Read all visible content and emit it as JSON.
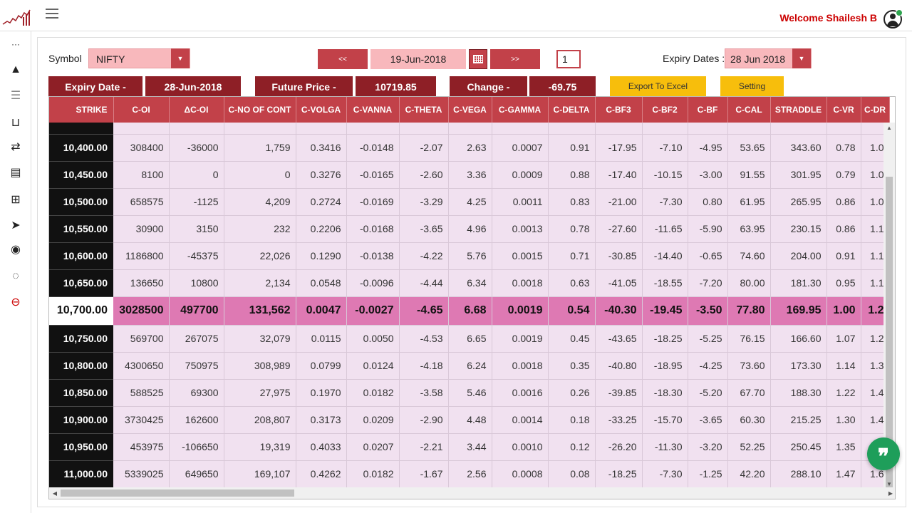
{
  "header": {
    "welcome": "Welcome Shailesh B",
    "logo_icon": "chart-logo-icon",
    "menu_icon": "hamburger-icon",
    "accent_color": "#c24149",
    "dark_accent": "#8e1f26",
    "welcome_color": "#cc0000"
  },
  "sidebar": {
    "items": [
      {
        "icon": "more-icon",
        "glyph": "···"
      },
      {
        "icon": "mountain-icon",
        "glyph": "▲"
      },
      {
        "icon": "list-lines-icon",
        "glyph": "☰"
      },
      {
        "icon": "basket-icon",
        "glyph": "⊔"
      },
      {
        "icon": "refresh-arrows-icon",
        "glyph": "⇄"
      },
      {
        "icon": "document-list-icon",
        "glyph": "▤"
      },
      {
        "icon": "map-icon",
        "glyph": "⊞"
      },
      {
        "icon": "paper-plane-icon",
        "glyph": "➤"
      },
      {
        "icon": "location-pin-icon",
        "glyph": "◉"
      },
      {
        "icon": "chat-bubble-icon",
        "glyph": "◌"
      },
      {
        "icon": "minus-circle-icon",
        "glyph": "⊖"
      }
    ]
  },
  "controls": {
    "symbol_label": "Symbol",
    "symbol_value": "NIFTY",
    "caret": "▼",
    "prev_label": "<<",
    "next_label": ">>",
    "date_value": "19-Jun-2018",
    "page_value": "1",
    "expiry_label": "Expiry Dates :",
    "expiry_value": "28 Jun 2018"
  },
  "info": {
    "expiry_label": "Expiry Date -",
    "expiry_value": "28-Jun-2018",
    "future_label": "Future Price -",
    "future_value": "10719.85",
    "change_label": "Change -",
    "change_value": "-69.75",
    "export_label": "Export To Excel",
    "setting_label": "Setting"
  },
  "table": {
    "headers": [
      "STRIKE",
      "C-OI",
      "ΔC-OI",
      "C-NO OF CONT",
      "C-VOLGA",
      "C-VANNA",
      "C-THETA",
      "C-VEGA",
      "C-GAMMA",
      "C-DELTA",
      "C-BF3",
      "C-BF2",
      "C-BF",
      "C-CAL",
      "STRADDLE",
      "C-VR",
      "C-DR"
    ],
    "rows": [
      [
        "10,400.00",
        "308400",
        "-36000",
        "1,759",
        "0.3416",
        "-0.0148",
        "-2.07",
        "2.63",
        "0.0007",
        "0.91",
        "-17.95",
        "-7.10",
        "-4.95",
        "53.65",
        "343.60",
        "0.78",
        "1.0"
      ],
      [
        "10,450.00",
        "8100",
        "0",
        "0",
        "0.3276",
        "-0.0165",
        "-2.60",
        "3.36",
        "0.0009",
        "0.88",
        "-17.40",
        "-10.15",
        "-3.00",
        "91.55",
        "301.95",
        "0.79",
        "1.0"
      ],
      [
        "10,500.00",
        "658575",
        "-1125",
        "4,209",
        "0.2724",
        "-0.0169",
        "-3.29",
        "4.25",
        "0.0011",
        "0.83",
        "-21.00",
        "-7.30",
        "0.80",
        "61.95",
        "265.95",
        "0.86",
        "1.0"
      ],
      [
        "10,550.00",
        "30900",
        "3150",
        "232",
        "0.2206",
        "-0.0168",
        "-3.65",
        "4.96",
        "0.0013",
        "0.78",
        "-27.60",
        "-11.65",
        "-5.90",
        "63.95",
        "230.15",
        "0.86",
        "1.1"
      ],
      [
        "10,600.00",
        "1186800",
        "-45375",
        "22,026",
        "0.1290",
        "-0.0138",
        "-4.22",
        "5.76",
        "0.0015",
        "0.71",
        "-30.85",
        "-14.40",
        "-0.65",
        "74.60",
        "204.00",
        "0.91",
        "1.1"
      ],
      [
        "10,650.00",
        "136650",
        "10800",
        "2,134",
        "0.0548",
        "-0.0096",
        "-4.44",
        "6.34",
        "0.0018",
        "0.63",
        "-41.05",
        "-18.55",
        "-7.20",
        "80.00",
        "181.30",
        "0.95",
        "1.1"
      ],
      [
        "10,700.00",
        "3028500",
        "497700",
        "131,562",
        "0.0047",
        "-0.0027",
        "-4.65",
        "6.68",
        "0.0019",
        "0.54",
        "-40.30",
        "-19.45",
        "-3.50",
        "77.80",
        "169.95",
        "1.00",
        "1.2"
      ],
      [
        "10,750.00",
        "569700",
        "267075",
        "32,079",
        "0.0115",
        "0.0050",
        "-4.53",
        "6.65",
        "0.0019",
        "0.45",
        "-43.65",
        "-18.25",
        "-5.25",
        "76.15",
        "166.60",
        "1.07",
        "1.2"
      ],
      [
        "10,800.00",
        "4300650",
        "750975",
        "308,989",
        "0.0799",
        "0.0124",
        "-4.18",
        "6.24",
        "0.0018",
        "0.35",
        "-40.80",
        "-18.95",
        "-4.25",
        "73.60",
        "173.30",
        "1.14",
        "1.3"
      ],
      [
        "10,850.00",
        "588525",
        "69300",
        "27,975",
        "0.1970",
        "0.0182",
        "-3.58",
        "5.46",
        "0.0016",
        "0.26",
        "-39.85",
        "-18.30",
        "-5.20",
        "67.70",
        "188.30",
        "1.22",
        "1.4"
      ],
      [
        "10,900.00",
        "3730425",
        "162600",
        "208,807",
        "0.3173",
        "0.0209",
        "-2.90",
        "4.48",
        "0.0014",
        "0.18",
        "-33.25",
        "-15.70",
        "-3.65",
        "60.30",
        "215.25",
        "1.30",
        "1.4"
      ],
      [
        "10,950.00",
        "453975",
        "-106650",
        "19,319",
        "0.4033",
        "0.0207",
        "-2.21",
        "3.44",
        "0.0010",
        "0.12",
        "-26.20",
        "-11.30",
        "-3.20",
        "52.25",
        "250.45",
        "1.35",
        "1.5"
      ],
      [
        "11,000.00",
        "5339025",
        "649650",
        "169,107",
        "0.4262",
        "0.0182",
        "-1.67",
        "2.56",
        "0.0008",
        "0.08",
        "-18.25",
        "-7.30",
        "-1.25",
        "42.20",
        "288.10",
        "1.47",
        "1.6"
      ]
    ],
    "atm_row_index": 6,
    "atm_color": "#de79b3",
    "row_color": "#f1e1f0"
  },
  "chat": {
    "icon": "quote-chat-icon",
    "glyph": "❞"
  }
}
